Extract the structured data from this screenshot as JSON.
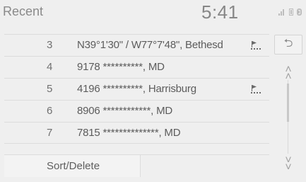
{
  "header": {
    "title": "Recent",
    "clock": "5:41"
  },
  "list": {
    "items": [
      {
        "index": "3",
        "label": "N39°1'30\" / W77°7'48\", Bethesd",
        "has_destination_icon": true
      },
      {
        "index": "4",
        "label": "9178 **********, MD",
        "has_destination_icon": false
      },
      {
        "index": "5",
        "label": "4196 **********, Harrisburg",
        "has_destination_icon": true
      },
      {
        "index": "6",
        "label": "8906 ************, MD",
        "has_destination_icon": false
      },
      {
        "index": "7",
        "label": "7815 **************, MD",
        "has_destination_icon": false
      }
    ]
  },
  "controls": {
    "back_icon": "return-arrow-icon",
    "scroll_up_icon": "double-chevron-up-icon",
    "scroll_down_icon": "double-chevron-down-icon"
  },
  "footer": {
    "sort_label": "Sort/Delete"
  }
}
